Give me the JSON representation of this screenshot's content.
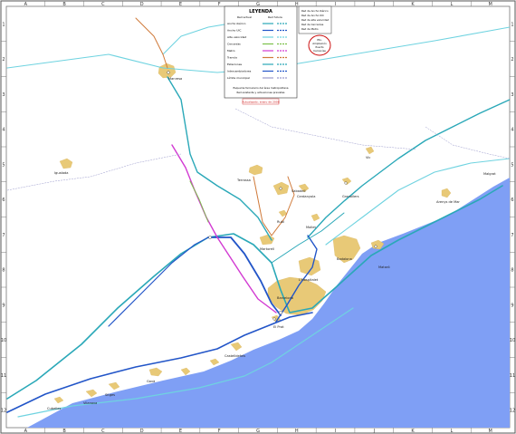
{
  "colors": {
    "sea": "#7f9ff5",
    "urban": "#e8c977",
    "rail_teal": "#2aa8b8",
    "rail_blue": "#2255c8",
    "rail_cyan": "#6fd3e0",
    "rail_orange": "#d07a3a",
    "rail_magenta": "#d23ad2",
    "rail_green": "#7cc04a",
    "frame": "#555555",
    "legend_red": "#cc1111"
  },
  "grid": {
    "cols_top": [
      "A",
      "B",
      "C",
      "D",
      "E",
      "F",
      "G",
      "H",
      "I",
      "J",
      "K",
      "L",
      "M"
    ],
    "cols_bottom": [
      "A",
      "B",
      "C",
      "D",
      "E",
      "F",
      "G",
      "H",
      "I",
      "J",
      "K",
      "L",
      "M"
    ],
    "rows_left": [
      "1",
      "2",
      "3",
      "4",
      "5",
      "6",
      "7",
      "8",
      "9",
      "10",
      "11",
      "12"
    ],
    "rows_right": [
      "1",
      "2",
      "3",
      "4",
      "5",
      "6",
      "7",
      "8",
      "9",
      "10",
      "11",
      "12"
    ]
  },
  "legend": {
    "title": "LEYENDA",
    "col_a": "Red actual",
    "col_b": "Red futura",
    "rows": [
      "Ancho ibérico",
      "Ancho UIC",
      "Alta velocidad",
      "Cercanías",
      "Metro",
      "Tranvía",
      "Estaciones",
      "Intercambiadores",
      "Límite municipal"
    ],
    "right_rows": [
      "Doble vía",
      "Vía única",
      "Vía electrificada",
      "Soterramiento"
    ],
    "footnote": "Esquema ferroviario del área metropolitana",
    "footnote2": "Red existente y actuaciones previstas",
    "date_tag": "Actualizado: enero de 2008"
  },
  "side_box": {
    "lines": [
      "Red de Ancho Ibérico",
      "Red de Ancho UIC",
      "Red de alta velocidad",
      "Red de Cercanías",
      "Red de Metro"
    ]
  },
  "circle_note": {
    "lines": [
      "Pto.",
      "Ampliación",
      "Puerto",
      "Cercanías"
    ]
  },
  "places": [
    {
      "id": "manresa",
      "label": "Manresa"
    },
    {
      "id": "terrassa",
      "label": "Terrassa"
    },
    {
      "id": "sabadell",
      "label": "Sabadell"
    },
    {
      "id": "granollers",
      "label": "Granollers"
    },
    {
      "id": "mataro",
      "label": "Mataró"
    },
    {
      "id": "martorell",
      "label": "Martorell"
    },
    {
      "id": "barcelona",
      "label": "Barcelona"
    },
    {
      "id": "badalona",
      "label": "Badalona"
    },
    {
      "id": "hospitalet",
      "label": "L'Hospitalet"
    },
    {
      "id": "prat",
      "label": "El Prat"
    },
    {
      "id": "castelldefels",
      "label": "Castelldefels"
    },
    {
      "id": "vilanova",
      "label": "Vilanova"
    },
    {
      "id": "igualada",
      "label": "Igualada"
    },
    {
      "id": "vic",
      "label": "Vic"
    },
    {
      "id": "arenys",
      "label": "Arenys de Mar"
    },
    {
      "id": "malgrat",
      "label": "Malgrat"
    },
    {
      "id": "rubi",
      "label": "Rubí"
    },
    {
      "id": "cerdanyola",
      "label": "Cerdanyola"
    },
    {
      "id": "mollet",
      "label": "Mollet"
    },
    {
      "id": "gava",
      "label": "Gavà"
    },
    {
      "id": "sitges",
      "label": "Sitges"
    },
    {
      "id": "cubelles",
      "label": "Cubelles"
    }
  ]
}
